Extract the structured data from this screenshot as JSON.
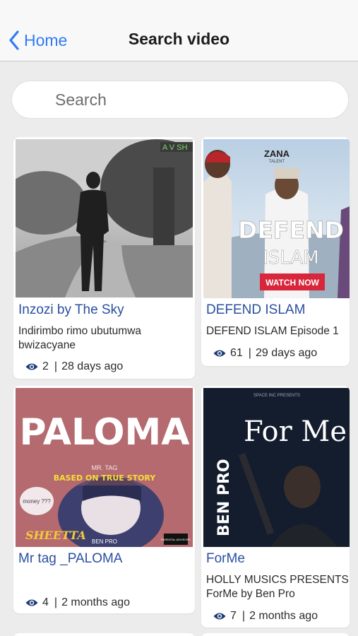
{
  "nav": {
    "back_label": "Home",
    "title": "Search video"
  },
  "search": {
    "placeholder": "Search",
    "value": ""
  },
  "videos": [
    {
      "title": "Inzozi by The Sky",
      "description": "Indirimbo rimo ubutumwa\nbwizacyane",
      "views": "2",
      "age": "28 days ago",
      "overlay_text": "A V  SH"
    },
    {
      "title": "DEFEND ISLAM",
      "description": "DEFEND ISLAM Episode 1",
      "views": "61",
      "age": "29 days ago",
      "brand": "ZANA",
      "brand_sub": "TALENT",
      "headline": "DEFEND",
      "headline2": "ISLAM",
      "cta": "WATCH NOW"
    },
    {
      "title": "Mr tag _PALOMA",
      "description": "",
      "views": "4",
      "age": "2 months ago",
      "headline": "PALOMA",
      "artist": "MR. TAG",
      "tagline": "BASED ON TRUE STORY",
      "feat": "SHEETTA",
      "producer": "BEN PRO",
      "bubble": "money ???",
      "advisory": "PARENTAL ADVISORY"
    },
    {
      "title": "ForMe",
      "description": "HOLLY MUSICS PRESENTS\nForMe by Ben Pro",
      "views": "7",
      "age": "2 months ago",
      "presenter": "SPACE  INC PRESENTS",
      "headline": "For Me",
      "artist": "BEN PRO"
    }
  ],
  "colors": {
    "accent": "#2f7cf6",
    "title_text": "#2a4fa0"
  }
}
